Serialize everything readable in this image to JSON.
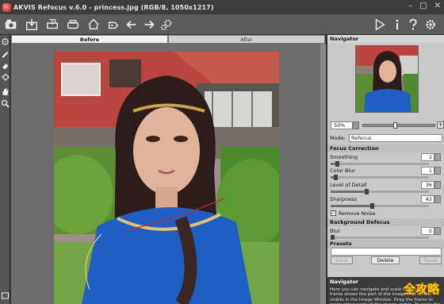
{
  "window": {
    "title": "AKVIS Refocus v.6.0 - princess.jpg (RGB/8, 1050x1217)",
    "controls": [
      "–",
      "□",
      "✕"
    ]
  },
  "toolbar": {
    "icons": [
      "open-file-icon",
      "save-icon",
      "print-icon",
      "export-icon",
      "share-icon",
      "undo-icon",
      "redo-icon",
      "settings-gear-icon",
      "run-play-icon",
      "info-icon",
      "help-icon",
      "preferences-gear-icon"
    ]
  },
  "tools": [
    "focus-brush-icon",
    "pencil-icon",
    "eraser-icon",
    "bucket-icon",
    "hand-icon",
    "zoom-icon"
  ],
  "tabs": {
    "before": "Before",
    "after": "After"
  },
  "navigator": {
    "title": "Navigator",
    "zoom": "50%",
    "zoom_level": 0.45
  },
  "settings": {
    "mode_label": "Mode:",
    "mode_value": "Refocus",
    "focus_correction": "Focus Correction",
    "smoothing_label": "Smoothing",
    "smoothing_value": "2",
    "smoothing_level": 0.05,
    "color_blur_label": "Color Blur",
    "color_blur_value": "1",
    "color_blur_level": 0.03,
    "level_detail_label": "Level of Detail",
    "level_detail_value": "36",
    "level_detail_level": 0.36,
    "sharpness_label": "Sharpness",
    "sharpness_value": "42",
    "sharpness_level": 0.42,
    "remove_noise_label": "Remove Noise",
    "remove_noise_checked": "✓",
    "background_defocus": "Background Defocus",
    "blur_label": "Blur",
    "blur_value": "0",
    "blur_level": 0.0
  },
  "presets": {
    "title": "Presets",
    "save_label": "Save",
    "delete_label": "Delete",
    "reset_label": "Reset"
  },
  "help": {
    "title": "Navigator",
    "text": "Here you can navigate and scale the image. The frame shows the part of the image that is now visible in the Image Window. Drag the frame to make other parts of the image visible. To scale the"
  },
  "watermark": "全攻略"
}
